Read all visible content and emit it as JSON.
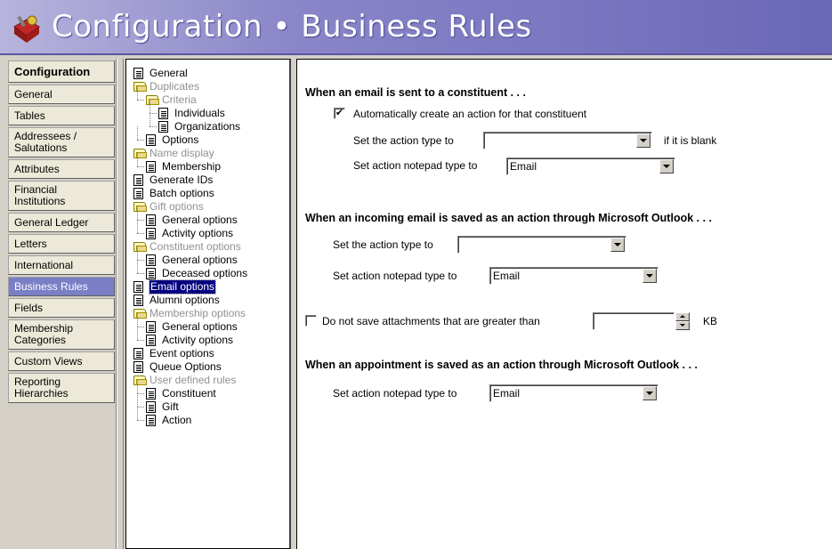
{
  "header": {
    "title": "Configuration • Business Rules",
    "icon": "toolbox-icon"
  },
  "nav": {
    "items": [
      {
        "label": "Configuration",
        "head": true
      },
      {
        "label": "General"
      },
      {
        "label": "Tables"
      },
      {
        "label": "Addressees / Salutations",
        "two": true
      },
      {
        "label": "Attributes"
      },
      {
        "label": "Financial Institutions",
        "two": true
      },
      {
        "label": "General Ledger"
      },
      {
        "label": "Letters"
      },
      {
        "label": "International"
      },
      {
        "label": "Business Rules",
        "active": true
      },
      {
        "label": "Fields"
      },
      {
        "label": "Membership Categories",
        "two": true
      },
      {
        "label": "Custom Views"
      },
      {
        "label": "Reporting Hierarchies",
        "two": true
      }
    ]
  },
  "tree": {
    "items": [
      {
        "label": "General",
        "type": "doc",
        "level": 0
      },
      {
        "label": "Duplicates",
        "type": "folder",
        "level": 0
      },
      {
        "label": "Criteria",
        "type": "folder",
        "level": 1
      },
      {
        "label": "Individuals",
        "type": "doc",
        "level": 2
      },
      {
        "label": "Organizations",
        "type": "doc",
        "level": 2
      },
      {
        "label": "Options",
        "type": "doc",
        "level": 1
      },
      {
        "label": "Name display",
        "type": "folder",
        "level": 0
      },
      {
        "label": "Membership",
        "type": "doc",
        "level": 1
      },
      {
        "label": "Generate IDs",
        "type": "doc",
        "level": 0
      },
      {
        "label": "Batch options",
        "type": "doc",
        "level": 0
      },
      {
        "label": "Gift options",
        "type": "folder",
        "level": 0
      },
      {
        "label": "General options",
        "type": "doc",
        "level": 1
      },
      {
        "label": "Activity options",
        "type": "doc",
        "level": 1
      },
      {
        "label": "Constituent options",
        "type": "folder",
        "level": 0
      },
      {
        "label": "General options",
        "type": "doc",
        "level": 1
      },
      {
        "label": "Deceased options",
        "type": "doc",
        "level": 1
      },
      {
        "label": "Email options",
        "type": "doc",
        "level": 0,
        "selected": true
      },
      {
        "label": "Alumni options",
        "type": "doc",
        "level": 0
      },
      {
        "label": "Membership options",
        "type": "folder",
        "level": 0
      },
      {
        "label": "General options",
        "type": "doc",
        "level": 1
      },
      {
        "label": "Activity options",
        "type": "doc",
        "level": 1
      },
      {
        "label": "Event options",
        "type": "doc",
        "level": 0
      },
      {
        "label": "Queue Options",
        "type": "doc",
        "level": 0
      },
      {
        "label": "User defined rules",
        "type": "folder",
        "level": 0
      },
      {
        "label": "Constituent",
        "type": "doc",
        "level": 1
      },
      {
        "label": "Gift",
        "type": "doc",
        "level": 1
      },
      {
        "label": "Action",
        "type": "doc",
        "level": 1
      }
    ]
  },
  "main": {
    "sec1_title": "When an email is sent to a constituent . . .",
    "auto_create_label": "Automatically create an action for that constituent",
    "auto_create_checked": true,
    "sec1_action_type_label": "Set the action type to",
    "sec1_action_type_value": "",
    "sec1_blank_label": "if it is blank",
    "sec1_notepad_label": "Set action notepad type to",
    "sec1_notepad_value": "Email",
    "sec2_title": "When an incoming email is saved as an action through Microsoft Outlook . . .",
    "sec2_action_type_label": "Set the action type to",
    "sec2_action_type_value": "",
    "sec2_notepad_label": "Set action notepad type to",
    "sec2_notepad_value": "Email",
    "attach_label": "Do not save attachments that are greater than",
    "attach_checked": false,
    "attach_value": "",
    "attach_unit": "KB",
    "sec3_title": "When an appointment is saved as an action through Microsoft Outlook . . .",
    "sec3_notepad_label": "Set action notepad type to",
    "sec3_notepad_value": "Email"
  }
}
